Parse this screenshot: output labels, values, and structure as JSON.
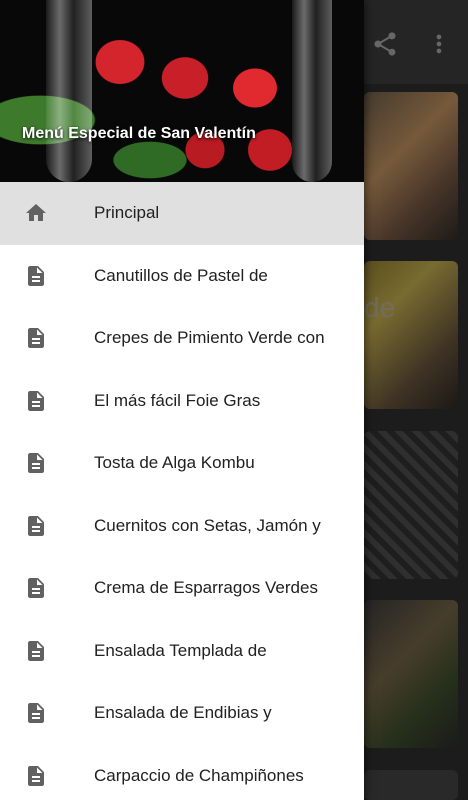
{
  "drawer": {
    "header_title": "Menú Especial de San Valentín",
    "items": [
      {
        "label": "Principal",
        "icon": "home-icon",
        "selected": true
      },
      {
        "label": "Canutillos de Pastel de",
        "icon": "document-icon"
      },
      {
        "label": "Crepes de Pimiento Verde con",
        "icon": "document-icon"
      },
      {
        "label": "El más fácil Foie Gras",
        "icon": "document-icon"
      },
      {
        "label": "Tosta de Alga Kombu",
        "icon": "document-icon"
      },
      {
        "label": "Cuernitos con Setas, Jamón y",
        "icon": "document-icon"
      },
      {
        "label": "Crema de Esparragos Verdes",
        "icon": "document-icon"
      },
      {
        "label": "Ensalada Templada de",
        "icon": "document-icon"
      },
      {
        "label": "Ensalada de Endibias y",
        "icon": "document-icon"
      },
      {
        "label": "Carpaccio de Champiñones",
        "icon": "document-icon"
      }
    ]
  },
  "background": {
    "card_partial_text": "de",
    "toolbar_icons": [
      "share-icon",
      "more-vert-icon"
    ]
  },
  "colors": {
    "icon_gray": "#616161",
    "selected_bg": "#e0e0e0",
    "app_bar": "#3a3a3a"
  }
}
